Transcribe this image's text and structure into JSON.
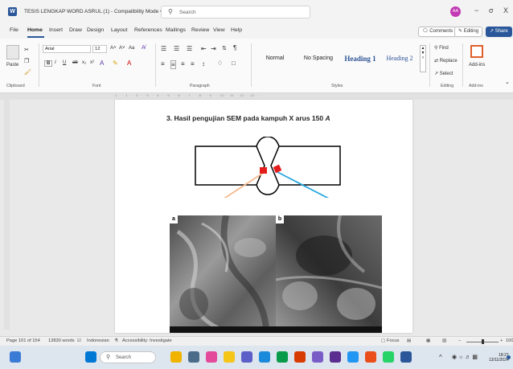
{
  "titlebar": {
    "doc_title": "TESIS LENGKAP WORD ASRUL (1)  -  Compatibility Mode  •  Saved to this PC ∨",
    "search_placeholder": "Search",
    "avatar_initials": "AA",
    "minimize": "−",
    "restore": "σ",
    "close": "X"
  },
  "menu": {
    "tabs": [
      "File",
      "Home",
      "Insert",
      "Draw",
      "Design",
      "Layout",
      "References",
      "Mailings",
      "Review",
      "View",
      "Help"
    ],
    "comments": "Comments",
    "editing": "Editing",
    "share": "Share"
  },
  "ribbon": {
    "clipboard": {
      "paste": "Paste",
      "label": "Clipboard"
    },
    "font": {
      "name": "Arial",
      "size": "12",
      "grow": "A˄",
      "shrink": "A˅",
      "case": "Aa",
      "bold": "B",
      "italic": "I",
      "underline": "U",
      "strike": "ab",
      "sub": "x₂",
      "sup": "x²",
      "label": "Font"
    },
    "paragraph": {
      "label": "Paragraph"
    },
    "styles": {
      "normal": "Normal",
      "no_spacing": "No Spacing",
      "heading1": "Heading 1",
      "heading2": "Heading 2",
      "label": "Styles"
    },
    "editing": {
      "find": "Find",
      "replace": "Replace",
      "select": "Select",
      "label": "Editing"
    },
    "addins": {
      "label": "Add-ins",
      "button": "Add-ins"
    }
  },
  "ruler": {
    "ticks": "· 1 · · · 1 · · · 2 · · · 3 · · · 4 · · · 5 · · · 6 · · · 7 · · · 8 · · · 9 · · · 10 · · 11 · · 12 · · 13 · · ·"
  },
  "document": {
    "heading_prefix": "3.   Hasil pengujian SEM pada kampuh X arus 150 ",
    "heading_unit": "A",
    "image_a_label": "a",
    "image_b_label": "b"
  },
  "statusbar": {
    "page": "Page 101 of 154",
    "words": "13830 words",
    "language": "Indonesian",
    "accessibility": "Accessibility: Investigate",
    "focus": "Focus",
    "zoom": "100"
  },
  "taskbar": {
    "search": "Search",
    "time": "18:27",
    "date": "13/11/2024"
  },
  "colors": {
    "word_blue": "#2b579a",
    "arrow_orange": "#f5b98c",
    "arrow_blue": "#2aa7e0",
    "marker_red": "#e51c1c"
  }
}
